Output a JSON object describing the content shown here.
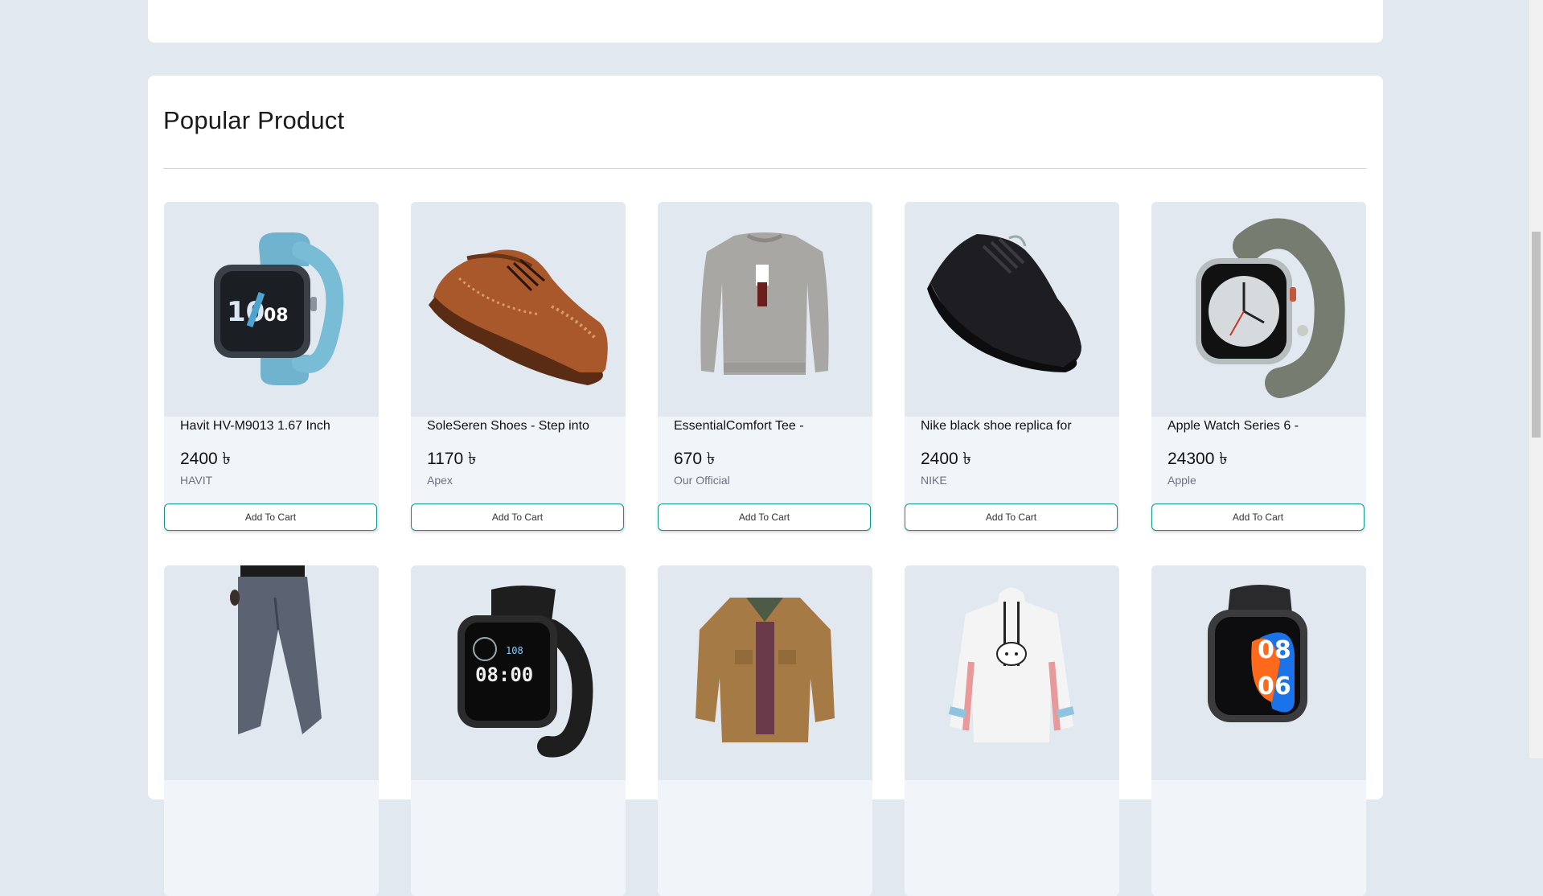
{
  "section": {
    "title": "Popular Product"
  },
  "products": [
    {
      "title": "Havit HV-M9013 1.67 Inch",
      "price": "2400 ৳",
      "brand": "HAVIT",
      "button": "Add To Cart",
      "icon": "smartwatch-blue-image"
    },
    {
      "title": "SoleSeren Shoes - Step into",
      "price": "1170 ৳",
      "brand": "Apex",
      "button": "Add To Cart",
      "icon": "brogue-shoe-image"
    },
    {
      "title": "EssentialComfort Tee -",
      "price": "670 ৳",
      "brand": "Our Official",
      "button": "Add To Cart",
      "icon": "sweatshirt-image"
    },
    {
      "title": "Nike black shoe replica for",
      "price": "2400 ৳",
      "brand": "NIKE",
      "button": "Add To Cart",
      "icon": "sneaker-image"
    },
    {
      "title": "Apple Watch Series 6 -",
      "price": "24300 ৳",
      "brand": "Apple",
      "button": "Add To Cart",
      "icon": "apple-watch-image"
    }
  ],
  "row2": [
    {
      "icon": "trousers-image"
    },
    {
      "icon": "smartwatch-black-image"
    },
    {
      "icon": "jacket-image"
    },
    {
      "icon": "hoodie-image"
    },
    {
      "icon": "smartwatch-colorful-image"
    }
  ]
}
